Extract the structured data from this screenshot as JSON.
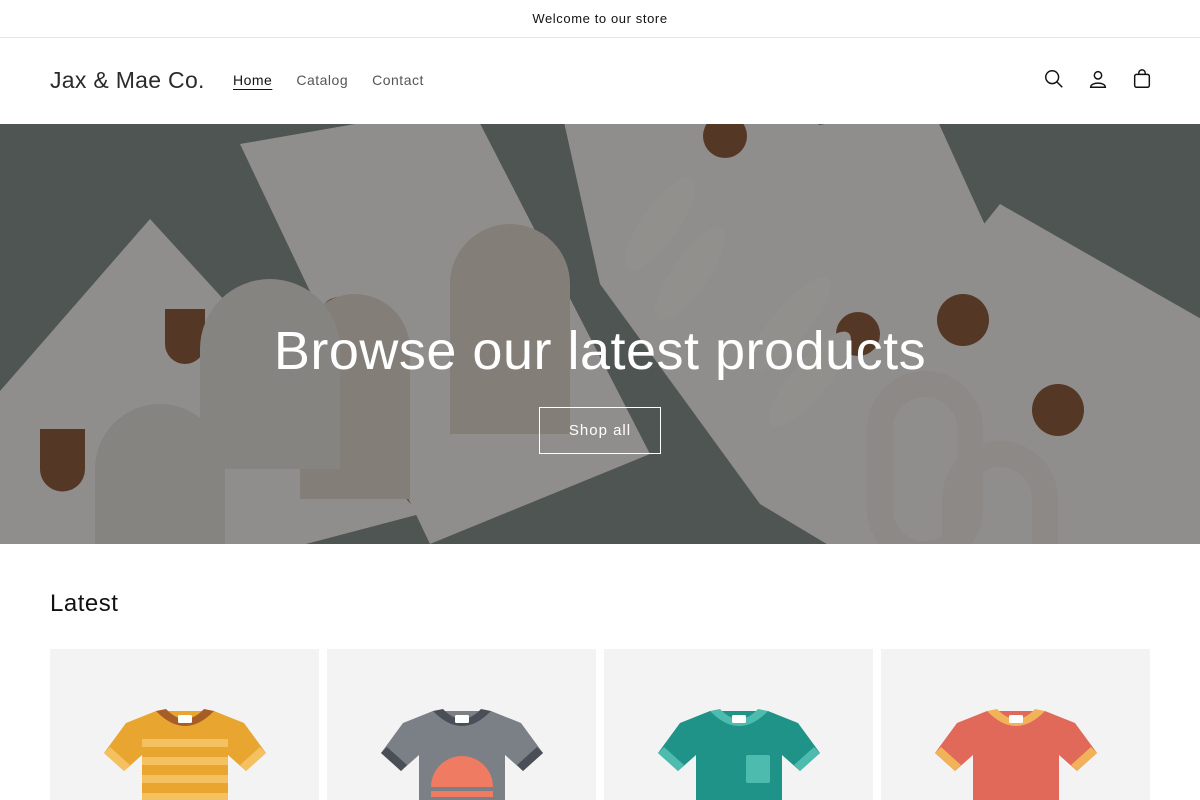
{
  "announcement": {
    "text": "Welcome to our store"
  },
  "header": {
    "logo": "Jax & Mae Co.",
    "nav": [
      {
        "label": "Home",
        "active": true
      },
      {
        "label": "Catalog",
        "active": false
      },
      {
        "label": "Contact",
        "active": false
      }
    ],
    "icons": [
      "search-icon",
      "account-icon",
      "cart-icon"
    ]
  },
  "hero": {
    "title": "Browse our latest products",
    "button": "Shop all",
    "image": "earrings-on-cards-photo"
  },
  "latest": {
    "title": "Latest",
    "products": [
      {
        "image": "striped-tshirt-icon",
        "color": "#e8a530",
        "accent": "#a65e26"
      },
      {
        "image": "gray-sunset-tshirt-icon",
        "color": "#7b7f86",
        "accent": "#4a4e56"
      },
      {
        "image": "teal-pocket-tshirt-icon",
        "color": "#1f9388",
        "accent": "#4dbcae"
      },
      {
        "image": "coral-tshirt-icon",
        "color": "#e1695a",
        "accent": "#f2b25a"
      }
    ]
  }
}
